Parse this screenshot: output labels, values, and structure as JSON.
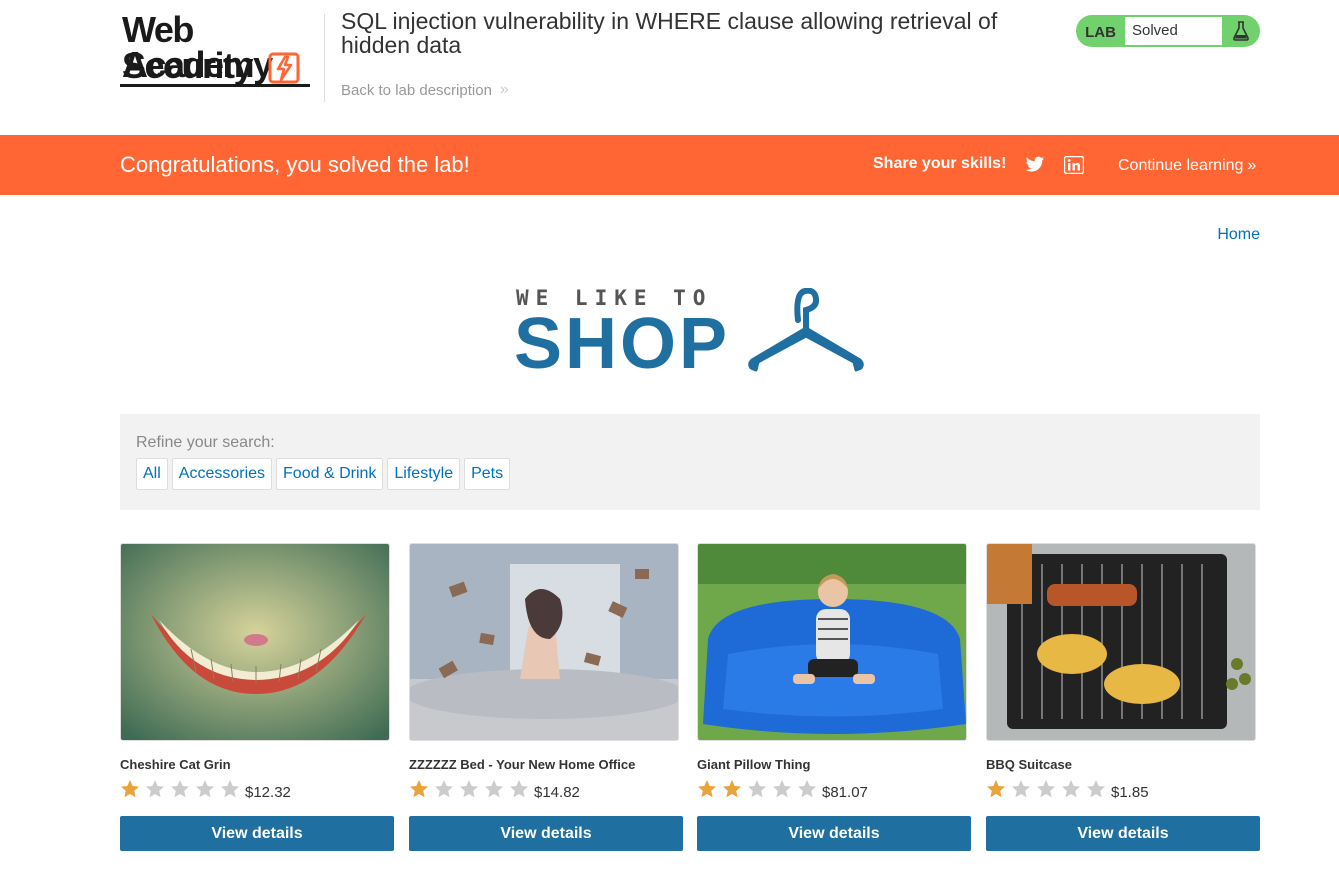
{
  "header": {
    "logo_line1": "Web Security",
    "logo_line2": "Academy",
    "lab_title": "SQL injection vulnerability in WHERE clause allowing retrieval of hidden data",
    "back_link": "Back to lab description",
    "lab_badge": "LAB",
    "lab_status": "Solved",
    "colors": {
      "solved_green": "#70d16d"
    }
  },
  "notification": {
    "message": "Congratulations, you solved the lab!",
    "share_label": "Share your skills!",
    "continue_label": "Continue learning",
    "icons": [
      "twitter-icon",
      "linkedin-icon"
    ],
    "color": "#ff6633"
  },
  "nav": {
    "home": "Home"
  },
  "banner": {
    "line1": "WE LIKE TO",
    "line2": "SHOP",
    "icon": "hanger-icon"
  },
  "filter": {
    "label": "Refine your search:",
    "categories": [
      "All",
      "Accessories",
      "Food & Drink",
      "Lifestyle",
      "Pets"
    ]
  },
  "products": [
    {
      "name": "Cheshire Cat Grin",
      "rating": 1,
      "price": "$12.32",
      "button": "View details"
    },
    {
      "name": "ZZZZZZ Bed - Your New Home Office",
      "rating": 1,
      "price": "$14.82",
      "button": "View details"
    },
    {
      "name": "Giant Pillow Thing",
      "rating": 2,
      "price": "$81.07",
      "button": "View details"
    },
    {
      "name": "BBQ Suitcase",
      "rating": 1,
      "price": "$1.85",
      "button": "View details"
    }
  ],
  "colors": {
    "primary": "#1f6fa0",
    "link": "#0071bc",
    "star_on": "#e8a33c",
    "star_off": "#cccccc"
  }
}
